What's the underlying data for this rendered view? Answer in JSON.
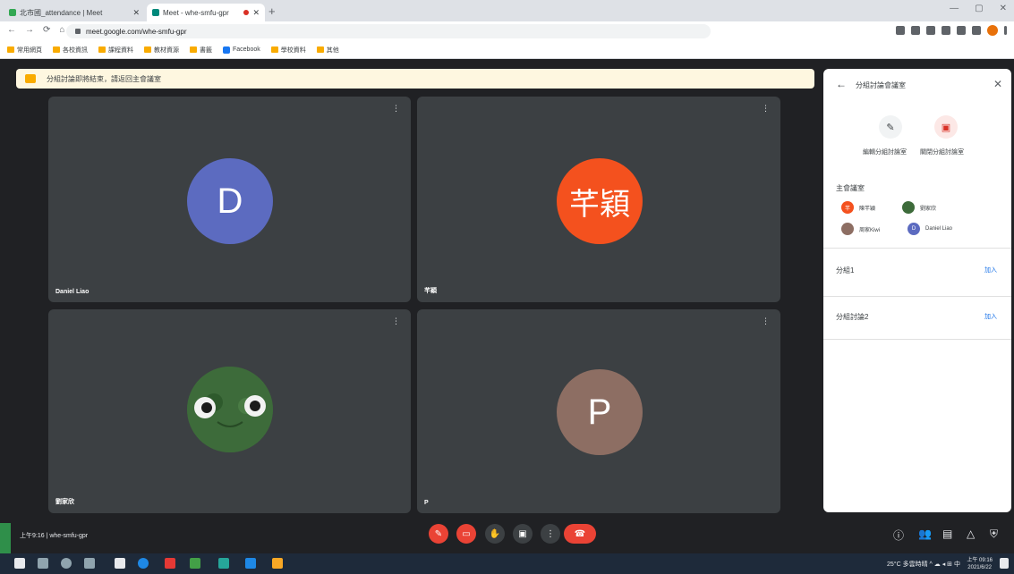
{
  "browser": {
    "tabs": [
      {
        "title": "北市國_attendance | Meet",
        "active": false
      },
      {
        "title": "Meet - whe-smfu-gpr",
        "active": true
      }
    ],
    "new_tab": "+",
    "window_controls": [
      "—",
      "▢",
      "✕"
    ],
    "nav": [
      "←",
      "→",
      "⟳",
      "⌂"
    ],
    "url": "meet.google.com/whe-smfu-gpr",
    "bookmarks": [
      "常用網頁",
      "各校資訊",
      "課程資料",
      "教材資源",
      "書籤",
      "Facebook",
      "學校資料",
      "其他"
    ]
  },
  "banner": {
    "text": "分組討論即將結束，請返回主會議室"
  },
  "tiles": [
    {
      "name": "Daniel Liao",
      "avatar_text": "D",
      "avatar_color": "#5c6bc0"
    },
    {
      "name": "芊穎",
      "avatar_text": "芊穎",
      "avatar_color": "#f4511e"
    },
    {
      "name": "劉家欣",
      "avatar_text": "",
      "avatar_color": "#3d6b3a"
    },
    {
      "name": "P",
      "avatar_text": "P",
      "avatar_color": "#8d6e63"
    }
  ],
  "tile_more": "⋮",
  "panel": {
    "title": "分組討論會議室",
    "back": "←",
    "close": "✕",
    "edit_label": "編輯分組討論室",
    "close_rooms_label": "關閉分組討論室",
    "main_room": "主會議室",
    "participants": [
      {
        "name": "陳芊穎",
        "color": "#f4511e",
        "initial": "芊"
      },
      {
        "name": "劉家欣",
        "color": "#3d6b3a",
        "initial": ""
      },
      {
        "name": "周家Kiwi",
        "color": "#8d6e63",
        "initial": ""
      },
      {
        "name": "Daniel Liao",
        "color": "#5c6bc0",
        "initial": "D"
      }
    ],
    "section2": "分組1",
    "section2_link": "加入",
    "section3": "分組討論2",
    "section3_link": "加入"
  },
  "bottom": {
    "meeting_info": "上午9:16 | whe-smfu-gpr",
    "controls": [
      "mic",
      "cam",
      "hand",
      "present",
      "more",
      "leave"
    ]
  },
  "taskbar": {
    "tray": "25°C 多雲時晴  ^ ☁ ◂ ⊞ 中",
    "time": "上午 09:16",
    "date": "2021/6/22"
  }
}
